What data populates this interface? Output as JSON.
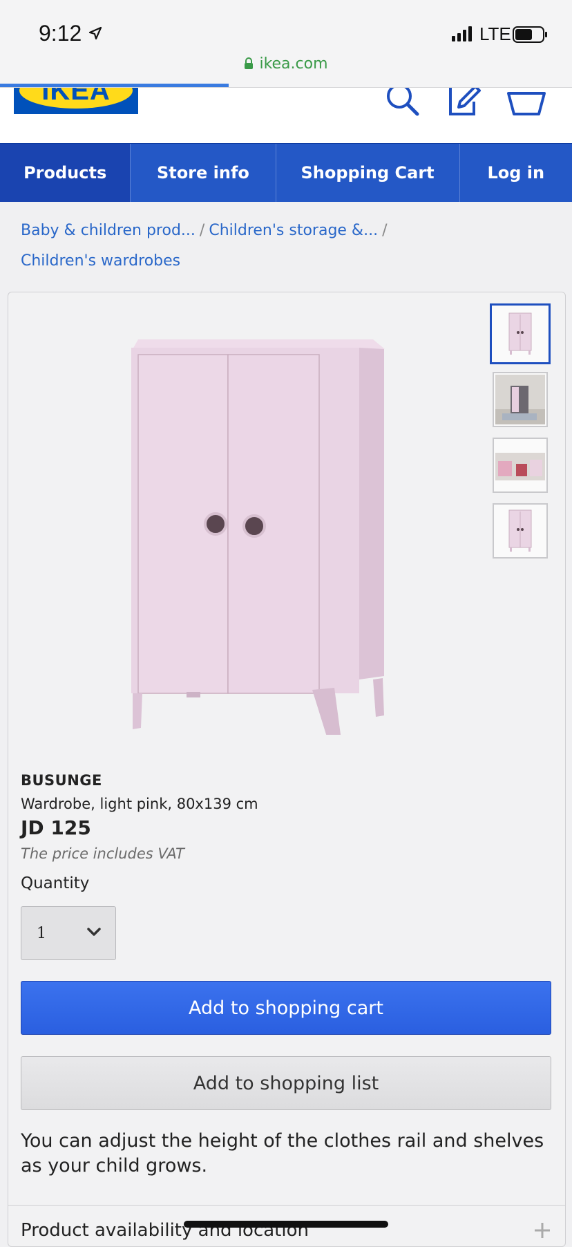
{
  "status_bar": {
    "time": "9:12",
    "network": "LTE",
    "url": "ikea.com"
  },
  "header": {
    "logo_text": "IKEA",
    "icons": [
      "search-icon",
      "shopping-list-icon",
      "basket-icon"
    ]
  },
  "nav": {
    "items": [
      {
        "label": "Products"
      },
      {
        "label": "Store info"
      },
      {
        "label": "Shopping Cart"
      },
      {
        "label": "Log in"
      }
    ]
  },
  "breadcrumb": {
    "items": [
      {
        "label": "Baby & children prod..."
      },
      {
        "label": "Children's storage &..."
      },
      {
        "label": "Children's wardrobes"
      }
    ],
    "separator": "/"
  },
  "product": {
    "name": "BUSUNGE",
    "description": "Wardrobe, light pink, 80x139 cm",
    "price": "JD 125",
    "vat_note": "The price includes VAT",
    "quantity_label": "Quantity",
    "quantity_value": "1",
    "add_to_cart": "Add to shopping cart",
    "add_to_list": "Add to shopping list",
    "blurb": "You can adjust the height of the clothes rail and shelves as your child grows.",
    "availability": "Product availability and location",
    "thumbnails_count": 4
  },
  "colors": {
    "ikea_blue": "#0051ba",
    "ikea_yellow": "#ffda1a",
    "nav_blue": "#2458c6",
    "link_blue": "#2967c9",
    "cart_button": "#2a5fe0",
    "product_pink": "#e8d3e3"
  }
}
